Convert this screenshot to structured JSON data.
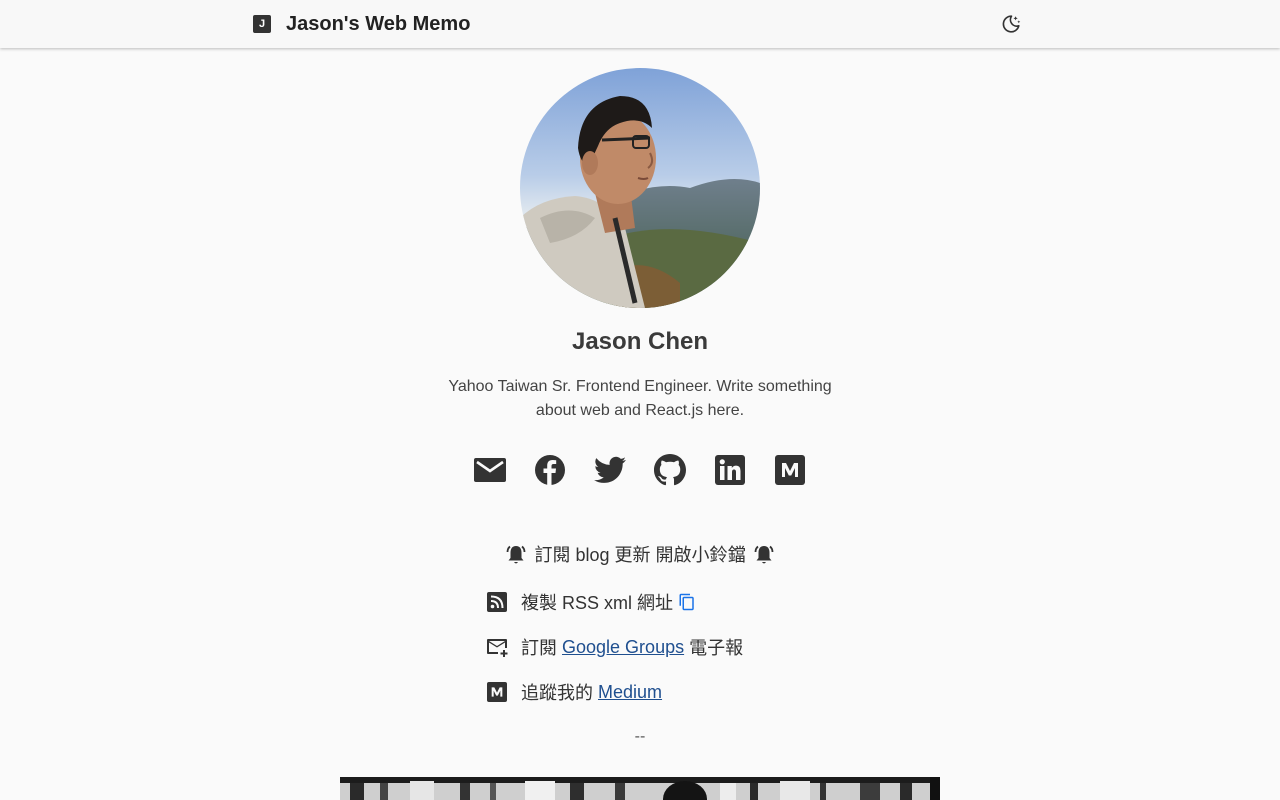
{
  "header": {
    "logo_letter": "J",
    "site_title": "Jason's Web Memo",
    "theme_icon": "moon-stars-icon"
  },
  "profile": {
    "name": "Jason Chen",
    "bio": "Yahoo Taiwan Sr. Frontend Engineer. Write something about web and React.js here."
  },
  "social_links": [
    {
      "name": "email",
      "icon": "email-icon"
    },
    {
      "name": "facebook",
      "icon": "facebook-icon"
    },
    {
      "name": "twitter",
      "icon": "twitter-icon"
    },
    {
      "name": "github",
      "icon": "github-icon"
    },
    {
      "name": "linkedin",
      "icon": "linkedin-icon"
    },
    {
      "name": "medium",
      "icon": "medium-icon"
    }
  ],
  "subscribe": {
    "heading": "訂閱 blog 更新 開啟小鈴鐺",
    "rss": {
      "text": "複製 RSS xml 網址",
      "icon": "rss-icon"
    },
    "google_groups": {
      "prefix": "訂閱",
      "link": "Google Groups",
      "suffix": "電子報",
      "icon": "email-add-icon"
    },
    "medium": {
      "prefix": "追蹤我的",
      "link": "Medium",
      "icon": "medium-icon"
    }
  },
  "separator": "--",
  "colors": {
    "background": "#fafafa",
    "link": "#1f4f8f",
    "copy_icon": "#1a73e8",
    "icon": "#333333"
  }
}
